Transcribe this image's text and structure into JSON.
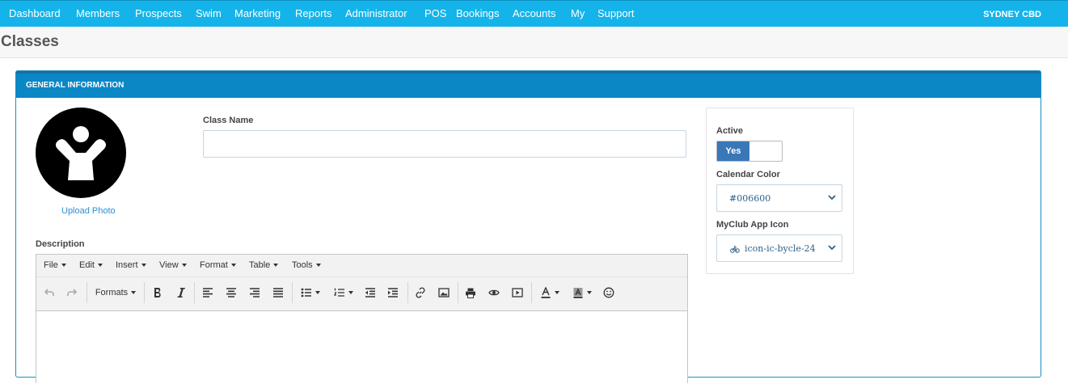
{
  "nav": {
    "items": [
      "Dashboard",
      "Members",
      "Prospects",
      "Swim",
      "Marketing",
      "Reports",
      "Administrator",
      "POS",
      "Bookings",
      "Accounts",
      "My",
      "Support"
    ],
    "location": "SYDNEY CBD"
  },
  "page": {
    "title": "Classes"
  },
  "panel": {
    "heading": "GENERAL INFORMATION"
  },
  "photo": {
    "upload_label": "Upload Photo",
    "icon": "person-arms-raised-icon"
  },
  "form": {
    "class_name_label": "Class Name",
    "class_name_value": "",
    "description_label": "Description",
    "active_label": "Active",
    "active_value": "Yes",
    "calendar_color_label": "Calendar Color",
    "calendar_color_value": "#006600",
    "app_icon_label": "MyClub App Icon",
    "app_icon_value": "icon-ic-bycle-24"
  },
  "editor": {
    "menu": [
      "File",
      "Edit",
      "Insert",
      "View",
      "Format",
      "Table",
      "Tools"
    ],
    "formats_label": "Formats",
    "tools": [
      "undo-icon",
      "redo-icon",
      "bold-icon",
      "italic-icon",
      "align-left-icon",
      "align-center-icon",
      "align-right-icon",
      "align-justify-icon",
      "bullet-list-icon",
      "numbered-list-icon",
      "outdent-icon",
      "indent-icon",
      "link-icon",
      "image-icon",
      "print-icon",
      "preview-icon",
      "media-icon",
      "text-color-icon",
      "background-color-icon",
      "emoticons-icon"
    ]
  },
  "colors": {
    "nav_bg": "#14b4ea",
    "panel_head": "#0a87c5",
    "toggle_on": "#3a77b8",
    "link": "#2d8fd0"
  }
}
